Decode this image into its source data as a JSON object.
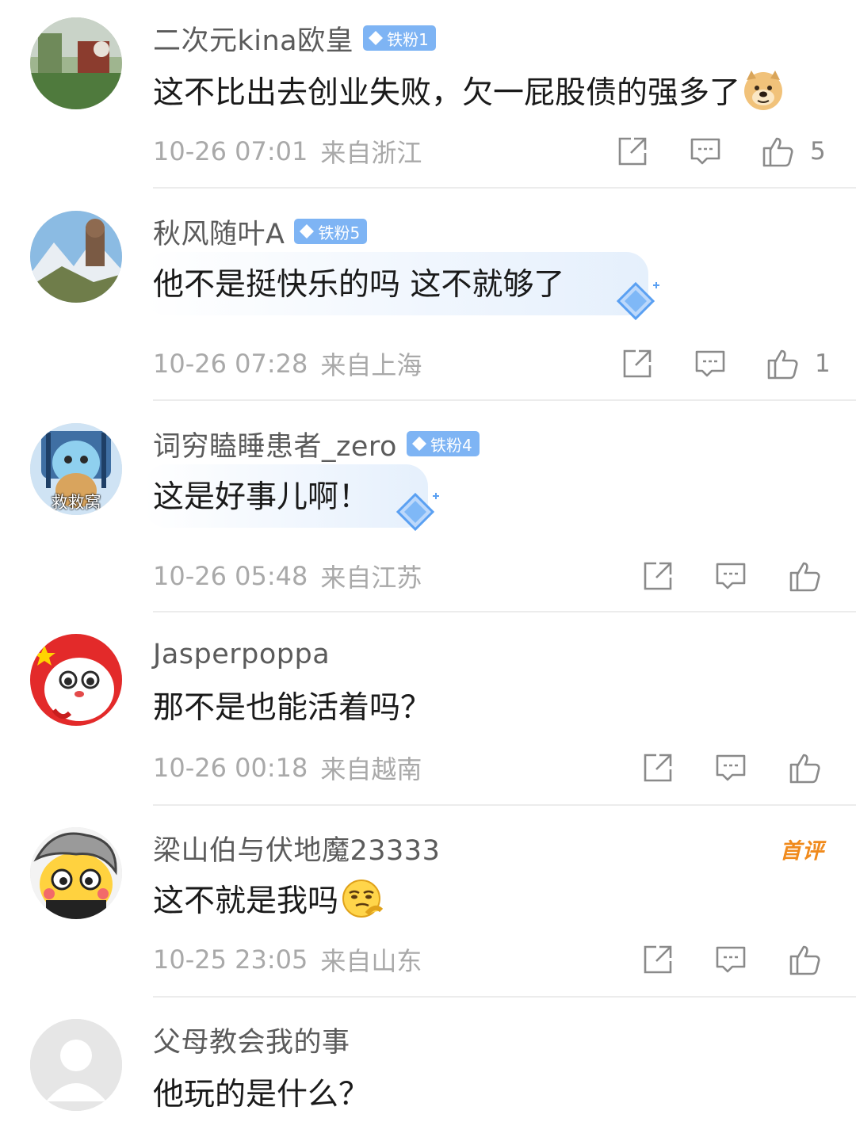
{
  "comments": [
    {
      "username": "二次元kina欧皇",
      "badge": "铁粉1",
      "text": "这不比出去创业失败，欠一屁股债的强多了",
      "emoji": "doge-emoji",
      "time": "10-26 07:01",
      "location": "来自浙江",
      "likes": "5"
    },
    {
      "username": "秋风随叶A",
      "badge": "铁粉5",
      "text": "他不是挺快乐的吗 这不就够了",
      "time": "10-26 07:28",
      "location": "来自上海",
      "likes": "1"
    },
    {
      "username": "词穷瞌睡患者_zero",
      "badge": "铁粉4",
      "text": "这是好事儿啊！",
      "avatar_text": "救救窝",
      "time": "10-26 05:48",
      "location": "来自江苏",
      "likes": ""
    },
    {
      "username": "Jasperpoppa",
      "text": "那不是也能活着吗？",
      "time": "10-26 00:18",
      "location": "来自越南",
      "likes": ""
    },
    {
      "username": "梁山伯与伏地魔23333",
      "first_tag": "首评",
      "text": "这不就是我吗",
      "emoji": "thinking-emoji",
      "time": "10-25 23:05",
      "location": "来自山东",
      "likes": ""
    },
    {
      "username": "父母教会我的事",
      "text": "他玩的是什么？"
    }
  ],
  "colors": {
    "name": "#5b5b5b",
    "text": "#1a1a1a",
    "meta": "#a9a9a9",
    "badge": "#7eb4f4",
    "first_tag": "#f08a1c"
  }
}
